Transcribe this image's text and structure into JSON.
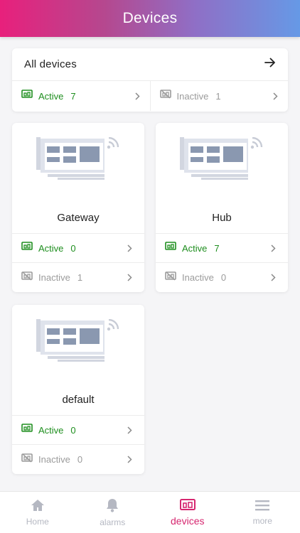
{
  "header": {
    "title": "Devices"
  },
  "summary": {
    "label": "All devices",
    "active_label": "Active",
    "active_count": "7",
    "inactive_label": "Inactive",
    "inactive_count": "1"
  },
  "groups": [
    {
      "name": "Gateway",
      "active_label": "Active",
      "active_count": "0",
      "inactive_label": "Inactive",
      "inactive_count": "1"
    },
    {
      "name": "Hub",
      "active_label": "Active",
      "active_count": "7",
      "inactive_label": "Inactive",
      "inactive_count": "0"
    },
    {
      "name": "default",
      "active_label": "Active",
      "active_count": "0",
      "inactive_label": "Inactive",
      "inactive_count": "0"
    }
  ],
  "tabs": [
    {
      "label": "Home",
      "icon": "home-icon"
    },
    {
      "label": "alarms",
      "icon": "bell-icon"
    },
    {
      "label": "devices",
      "icon": "devices-icon",
      "selected": true
    },
    {
      "label": "more",
      "icon": "menu-icon"
    }
  ],
  "colors": {
    "active": "#1e8e1e",
    "inactive": "#9b9b9b",
    "accent": "#d6266f"
  }
}
